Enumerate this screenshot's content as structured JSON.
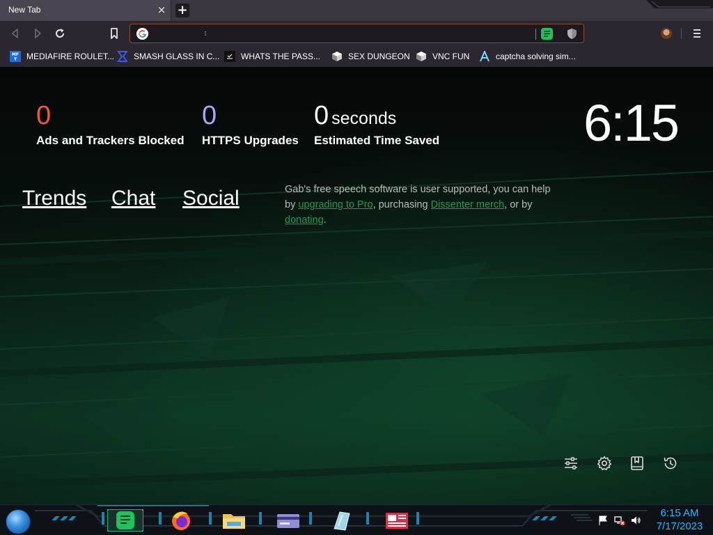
{
  "browser": {
    "tab": {
      "title": "New Tab",
      "close_glyph": "×"
    },
    "new_tab_glyph": "+",
    "toolbar": {
      "back_icon": "back-arrow-icon",
      "forward_icon": "forward-arrow-icon",
      "reload_icon": "reload-icon",
      "bookmark_icon": "bookmark-icon",
      "search_engine_icon": "google-g-icon",
      "omnibox_value": "",
      "extension_icons": [
        "chat-extension-icon",
        "shield-extension-icon"
      ],
      "menu_icon": "hamburger-menu-icon"
    },
    "bookmarks": [
      {
        "label": "MEDIAFIRE ROULET...",
        "icon": "mediafire-icon"
      },
      {
        "label": "SMASH GLASS IN C...",
        "icon": "chevron-brand-icon"
      },
      {
        "label": "WHATS THE PASS...",
        "icon": "site-icon"
      },
      {
        "label": "SEX DUNGEON",
        "icon": "cube-icon"
      },
      {
        "label": "VNC FUN",
        "icon": "cube-icon"
      },
      {
        "label": "captcha solving sim...",
        "icon": "caret-a-icon"
      }
    ]
  },
  "new_tab_page": {
    "stats": [
      {
        "value": "0",
        "unit": "",
        "label": "Ads and Trackers Blocked",
        "color": "#ea5a3d"
      },
      {
        "value": "0",
        "unit": "",
        "label": "HTTPS Upgrades",
        "color": "#a6a9f5"
      },
      {
        "value": "0",
        "unit": "seconds",
        "label": "Estimated Time Saved",
        "color": "#ffffff"
      }
    ],
    "clock": "6:15",
    "links": [
      "Trends",
      "Chat",
      "Social"
    ],
    "note": {
      "part1": "Gab's free speech software is user supported, you can help by ",
      "link1": "upgrading to Pro",
      "part2": ", purchasing ",
      "link2": "Dissenter merch",
      "part3": ", or by ",
      "link3": "donating",
      "part4": "."
    },
    "tools": [
      "customize-sliders-icon",
      "settings-gear-icon",
      "bookmarks-icon",
      "history-icon"
    ]
  },
  "taskbar": {
    "start_icon": "start-orb-icon",
    "apps": [
      "chat-app-icon",
      "firefox-icon",
      "file-explorer-icon",
      "card-app-icon",
      "glass-app-icon",
      "news-app-icon"
    ],
    "tray_icons": [
      "action-center-flag-icon",
      "network-disconnected-icon",
      "volume-icon"
    ],
    "time": "6:15 AM",
    "date": "7/17/2023"
  },
  "colors": {
    "accent_orange_border": "#8a4d2c",
    "link_green": "#1f9b56",
    "taskbar_text": "#21b9ff"
  }
}
